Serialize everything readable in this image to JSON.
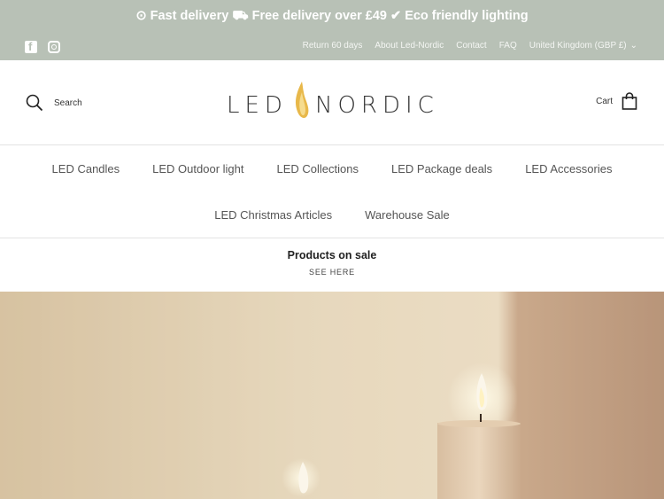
{
  "promo": {
    "item1": "Fast delivery",
    "item2": "Free delivery over £49",
    "item3": "Eco friendly lighting"
  },
  "social": {
    "facebook_icon": "facebook-icon",
    "instagram_icon": "instagram-icon"
  },
  "toplinks": {
    "return": "Return 60 days",
    "about": "About Led-Nordic",
    "contact": "Contact",
    "faq": "FAQ",
    "country": "United Kingdom (GBP £)"
  },
  "header": {
    "search_label": "Search",
    "logo_left": "LED",
    "logo_right": "NORDIC",
    "cart_label": "Cart"
  },
  "nav": {
    "row1": [
      "LED Candles",
      "LED Outdoor light",
      "LED Collections",
      "LED Package deals",
      "LED Accessories"
    ],
    "row2": [
      "LED Christmas Articles",
      "Warehouse Sale"
    ]
  },
  "sale_banner": {
    "title": "Products on sale",
    "cta": "SEE HERE"
  },
  "colors": {
    "topbar_bg": "#b8c1b6",
    "flame": "#e8b84a"
  }
}
